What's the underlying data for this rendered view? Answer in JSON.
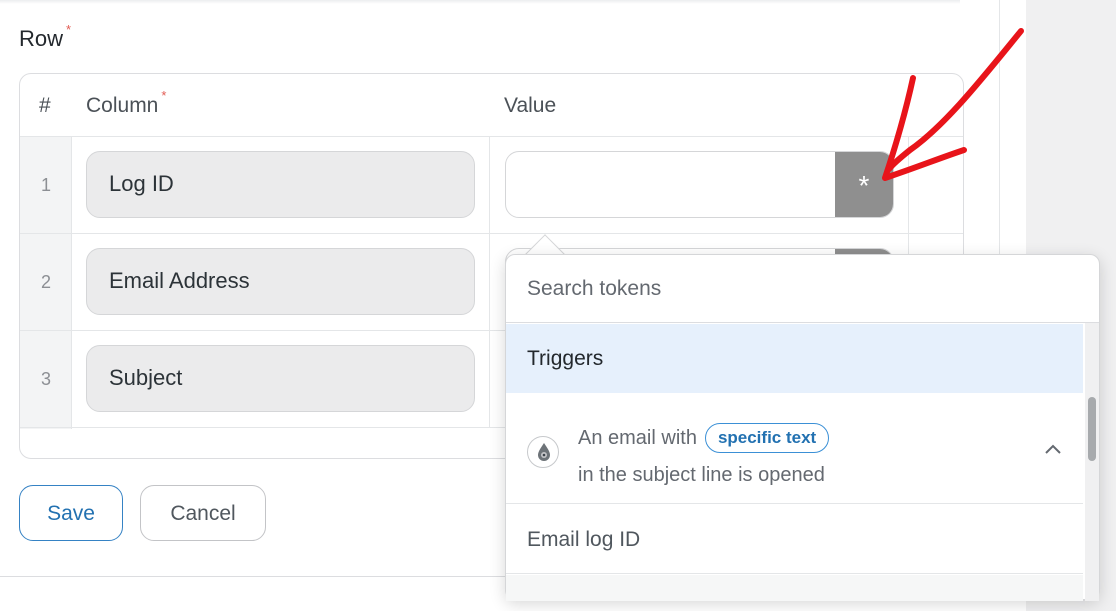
{
  "form": {
    "row_label": "Row",
    "required_mark": "*"
  },
  "table": {
    "headers": {
      "index": "#",
      "column": "Column",
      "value": "Value"
    },
    "rows": [
      {
        "index": "1",
        "column": "Log ID",
        "value": ""
      },
      {
        "index": "2",
        "column": "Email Address",
        "value": ""
      },
      {
        "index": "3",
        "column": "Subject",
        "value": ""
      }
    ],
    "token_button_label": "*"
  },
  "buttons": {
    "save": "Save",
    "cancel": "Cancel"
  },
  "token_popup": {
    "search_placeholder": "Search tokens",
    "group_title": "Triggers",
    "trigger": {
      "text_before": "An email with",
      "badge": "specific text",
      "text_after": "in the subject line is opened",
      "icon": "uncanny-automator-icon",
      "expand_icon": "chevron-up-icon"
    },
    "tokens": [
      "Email log ID"
    ]
  },
  "colors": {
    "accent": "#2271b1",
    "token_button": "#8f8f8f",
    "group_header_bg": "#e6f0fc",
    "annotation_arrow": "#e8141a"
  }
}
